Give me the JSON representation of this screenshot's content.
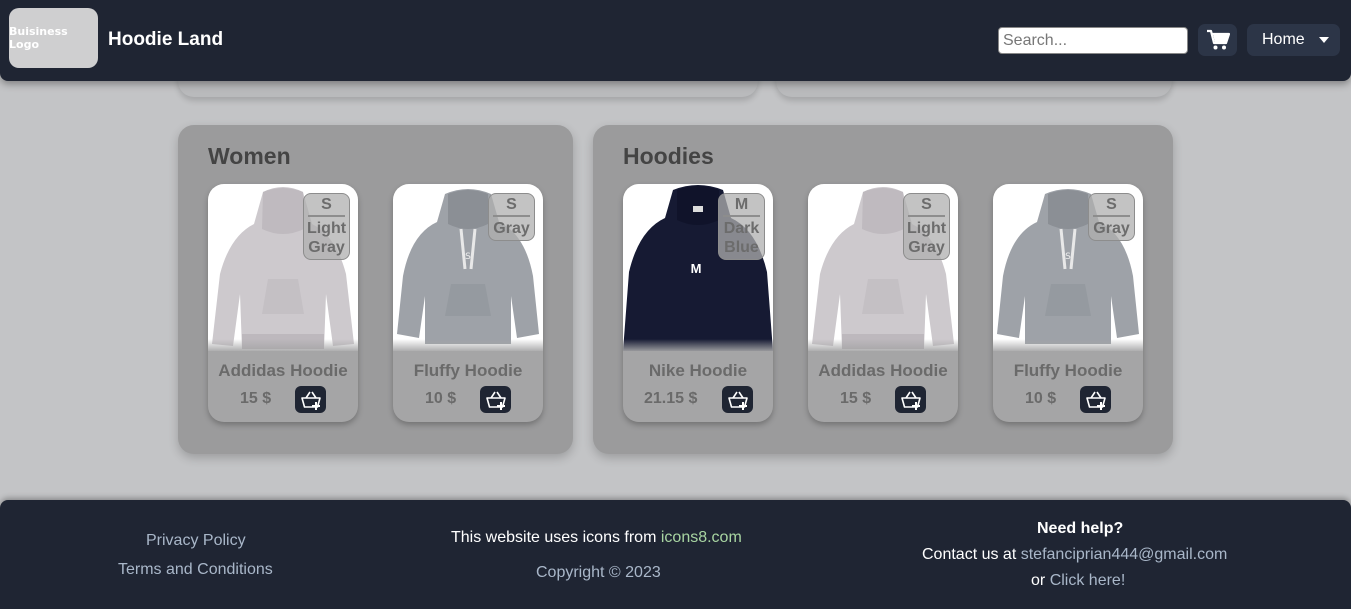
{
  "header": {
    "logo_text": "Buisiness Logo",
    "title": "Hoodie Land",
    "search_placeholder": "Search...",
    "cart_icon": "cart-icon",
    "home_label": "Home"
  },
  "categories": [
    {
      "title": "Women",
      "products": [
        {
          "name": "Addidas Hoodie",
          "price": "15 $",
          "size": "S",
          "color": "Light Gray",
          "image": "light-gray-hoodie"
        },
        {
          "name": "Fluffy Hoodie",
          "price": "10 $",
          "size": "S",
          "color": "Gray",
          "image": "gray-hoodie"
        }
      ]
    },
    {
      "title": "Hoodies",
      "products": [
        {
          "name": "Nike Hoodie",
          "price": "21.15 $",
          "size": "M",
          "color": "Dark Blue",
          "image": "dark-blue-hoodie",
          "print": "M"
        },
        {
          "name": "Addidas Hoodie",
          "price": "15 $",
          "size": "S",
          "color": "Light Gray",
          "image": "light-gray-hoodie"
        },
        {
          "name": "Fluffy Hoodie",
          "price": "10 $",
          "size": "S",
          "color": "Gray",
          "image": "gray-hoodie"
        }
      ]
    }
  ],
  "footer": {
    "privacy": "Privacy Policy",
    "terms": "Terms and Conditions",
    "icons_prefix": "This website uses icons from",
    "icons_link": "icons8.com",
    "copyright": "Copyright © 2023",
    "help_title": "Need help?",
    "contact_prefix": "Contact us at",
    "contact_email": "stefanciprian444@gmail.com",
    "or_text": "or",
    "click_here": "Click here!"
  },
  "colors": {
    "navy": "#1f2533",
    "background": "#c3c4c6",
    "panel": "#9b9b9c",
    "link_green": "#a8d5a2",
    "link_blue": "#a9b7c9"
  }
}
